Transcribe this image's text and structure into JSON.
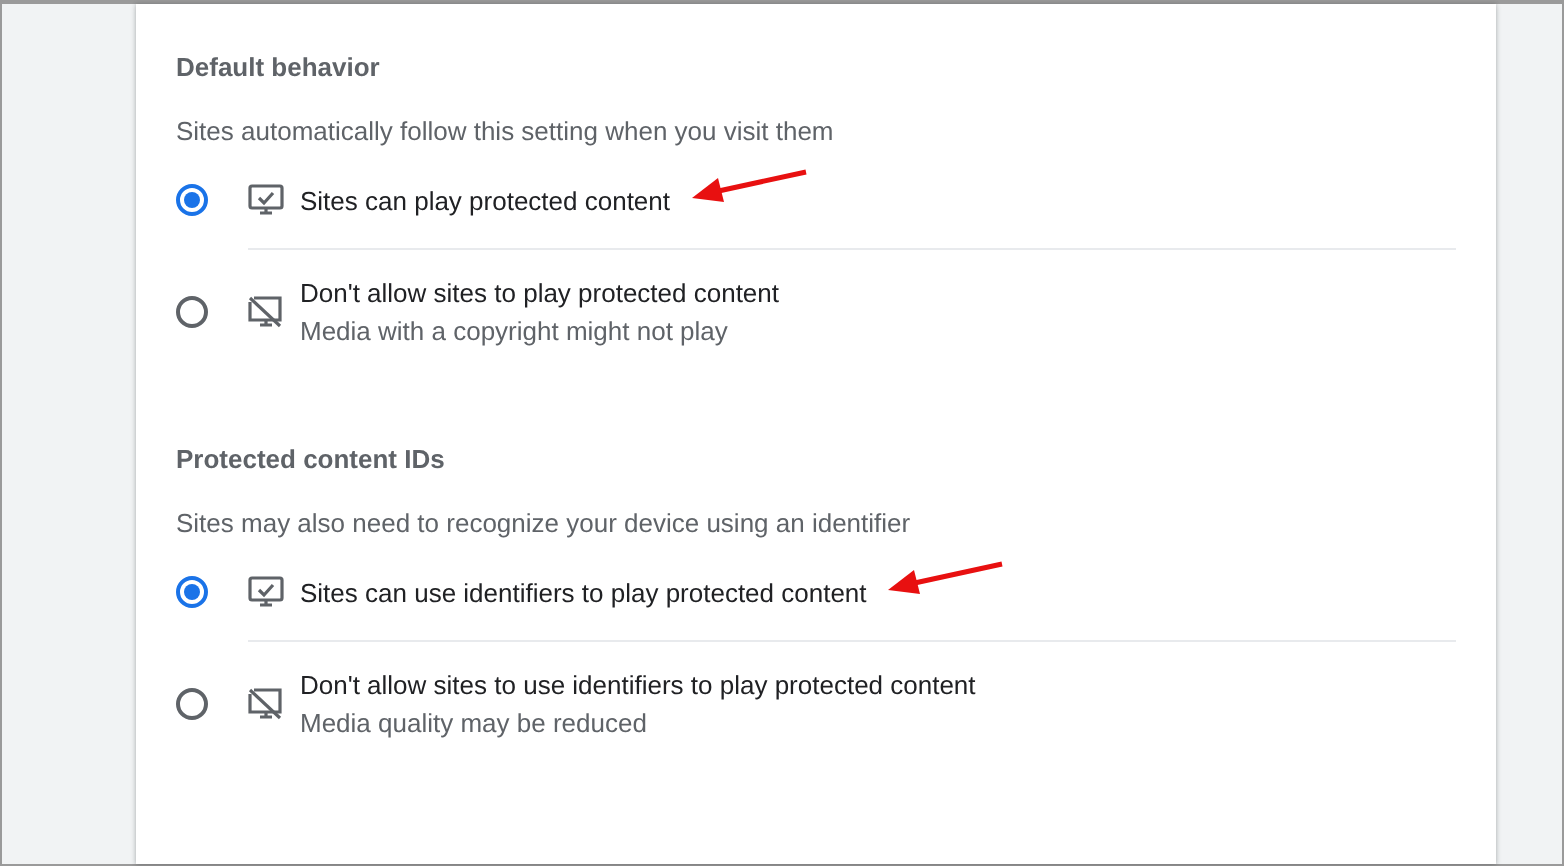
{
  "sections": [
    {
      "heading": "Default behavior",
      "description": "Sites automatically follow this setting when you visit them",
      "options": [
        {
          "label": "Sites can play protected content",
          "kind": "allow",
          "selected": true,
          "arrow": true
        },
        {
          "label": "Don't allow sites to play protected content",
          "sublabel": "Media with a copyright might not play",
          "kind": "block",
          "selected": false,
          "arrow": false
        }
      ]
    },
    {
      "heading": "Protected content IDs",
      "description": "Sites may also need to recognize your device using an identifier",
      "options": [
        {
          "label": "Sites can use identifiers to play protected content",
          "kind": "allow",
          "selected": true,
          "arrow": true
        },
        {
          "label": "Don't allow sites to use identifiers to play protected content",
          "sublabel": "Media quality may be reduced",
          "kind": "block",
          "selected": false,
          "arrow": false
        }
      ]
    }
  ]
}
